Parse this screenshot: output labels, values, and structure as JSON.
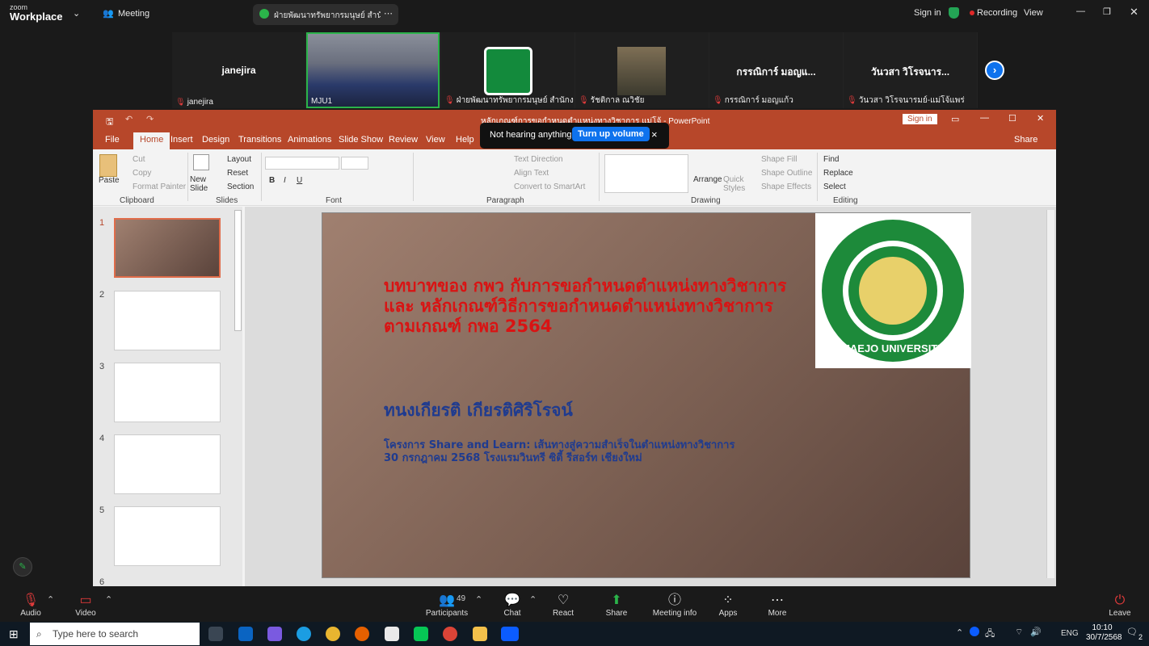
{
  "zoom": {
    "brand_small": "zoom",
    "brand_large": "Workplace",
    "meeting_label": "Meeting",
    "share_title": "ฝ่ายพัฒนาทรัพยากรมนุษย์ สำนักงานแม",
    "sign_in": "Sign in",
    "recording": "Recording",
    "view": "View"
  },
  "gallery": {
    "tiles": [
      {
        "name_center": "janejira",
        "label": "janejira"
      },
      {
        "label": "MJU1"
      },
      {
        "label": "ฝ่ายพัฒนาทรัพยากรมนุษย์ สำนักงาน..."
      },
      {
        "label": "รัชติกาล ณวิชัย"
      },
      {
        "name_center": "กรรณิการ์ มอญแ...",
        "label": "กรรณิการ์ มอญแก้ว"
      },
      {
        "name_center": "วันวสา วิโรจนาร...",
        "label": "วันวสา วิโรจนารมย์-แม่โจ้แพร่"
      }
    ],
    "next": "›"
  },
  "ppt": {
    "title": "หลักเกณฑ์การขอกำหนดตำแหน่งทางวิชาการ แม่โจ้ - PowerPoint",
    "sign_in": "Sign in",
    "share": "Share",
    "tabs": [
      "File",
      "Home",
      "Insert",
      "Design",
      "Transitions",
      "Animations",
      "Slide Show",
      "Review",
      "View",
      "Help"
    ],
    "ribbon": {
      "paste": "Paste",
      "cut": "Cut",
      "copy": "Copy",
      "format_painter": "Format Painter",
      "clipboard": "Clipboard",
      "new_slide": "New Slide",
      "layout": "Layout",
      "reset": "Reset",
      "section": "Section",
      "slides": "Slides",
      "font": "Font",
      "paragraph": "Paragraph",
      "text_direction": "Text Direction",
      "align_text": "Align Text",
      "convert": "Convert to SmartArt",
      "arrange": "Arrange",
      "quick_styles": "Quick Styles",
      "shape_fill": "Shape Fill",
      "shape_outline": "Shape Outline",
      "shape_effects": "Shape Effects",
      "drawing": "Drawing",
      "find": "Find",
      "replace": "Replace",
      "select": "Select",
      "editing": "Editing"
    },
    "thumb_numbers": [
      "1",
      "2",
      "3",
      "4",
      "5",
      "6"
    ],
    "slide": {
      "title": "บทบาทของ กพว กับการขอกำหนดตำแหน่งทางวิชาการ และ หลักเกณฑ์วิธีการขอกำหนดตำแหน่งทางวิชาการตามเกณฑ์ กพอ 2564",
      "name": "ทนงเกียรติ เกียรติศิริโรจน์",
      "sub1": "โครงการ Share and Learn: เส้นทางสู่ความสำเร็จในตำแหน่งทางวิชาการ",
      "sub2": "30 กรกฎาคม 2568 โรงแรมวินทรี ซิตี้ รีสอร์ท เชียงใหม่",
      "logo_text": "MAEJO UNIVERSITY"
    }
  },
  "toast": {
    "text": "Not hearing anything?",
    "button": "Turn up volume",
    "close": "×"
  },
  "controls": {
    "audio": "Audio",
    "video": "Video",
    "participants": "Participants",
    "participants_count": "49",
    "chat": "Chat",
    "react": "React",
    "share": "Share",
    "meeting_info": "Meeting info",
    "apps": "Apps",
    "more": "More",
    "leave": "Leave"
  },
  "taskbar": {
    "search": "Type here to search",
    "lang": "ENG",
    "time": "10:10",
    "date": "30/7/2568",
    "notif": "2"
  }
}
